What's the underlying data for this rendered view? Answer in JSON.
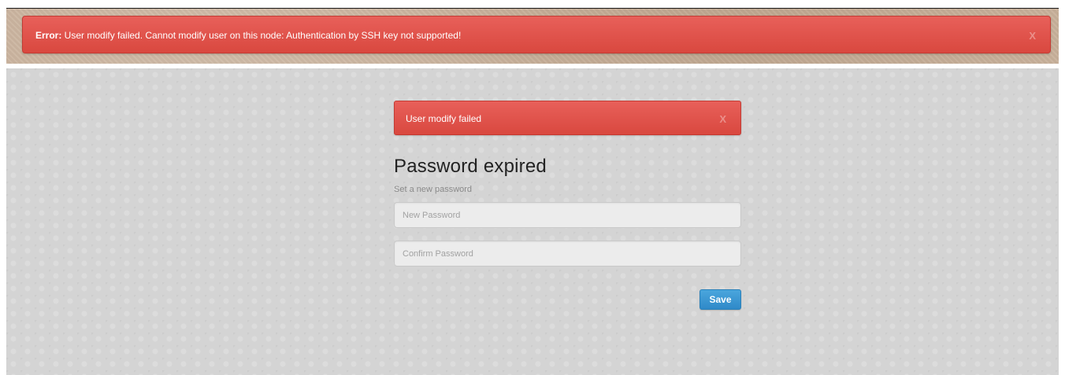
{
  "top_alert": {
    "prefix": "Error:",
    "message": " User modify failed. Cannot modify user on this node: Authentication by SSH key not supported!",
    "close_label": "X"
  },
  "form_alert": {
    "message": "User modify failed",
    "close_label": "X"
  },
  "form": {
    "title": "Password expired",
    "subtitle": "Set a new password",
    "new_password": {
      "value": "",
      "placeholder": "New Password"
    },
    "confirm_password": {
      "value": "",
      "placeholder": "Confirm Password"
    },
    "save_label": "Save"
  },
  "colors": {
    "alert_red": "#e05850",
    "button_blue": "#3b95d2",
    "background_grey": "#d4d4d4",
    "banner_beige": "#c9b29c"
  }
}
